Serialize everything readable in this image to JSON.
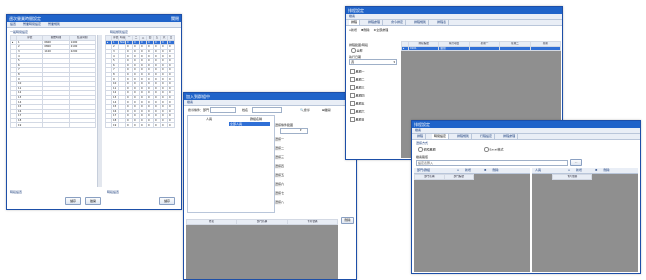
{
  "w1": {
    "title": "週次營業時間設定",
    "close": "關閉",
    "menu": [
      "設置",
      "營業時間設定",
      "營業規則"
    ],
    "left_section": "一般時間設定",
    "left_headers": [
      "序號",
      "開始時間",
      "結束時間"
    ],
    "left_rows": [
      [
        "1",
        "0600",
        "1400"
      ],
      [
        "2",
        "0800",
        "2100"
      ],
      [
        "3",
        "1100",
        "2200"
      ],
      [
        "4",
        "",
        ""
      ],
      [
        "5",
        "",
        ""
      ],
      [
        "6",
        "",
        ""
      ],
      [
        "7",
        "",
        ""
      ],
      [
        "8",
        "",
        ""
      ],
      [
        "9",
        "",
        ""
      ],
      [
        "10",
        "",
        ""
      ],
      [
        "11",
        "",
        ""
      ],
      [
        "12",
        "",
        ""
      ],
      [
        "13",
        "",
        ""
      ],
      [
        "14",
        "",
        ""
      ],
      [
        "15",
        "",
        ""
      ],
      [
        "16",
        "",
        ""
      ],
      [
        "17",
        "",
        ""
      ],
      [
        "18",
        "",
        ""
      ],
      [
        "19",
        "",
        ""
      ]
    ],
    "right_section": "時段類別設定",
    "right_headers": [
      "序號",
      "時段名稱",
      "一",
      "二",
      "三",
      "四",
      "五",
      "六",
      "日"
    ],
    "right_rows": [
      [
        "1",
        "Normal",
        "0",
        "0",
        "0",
        "0",
        "0",
        "0",
        "0"
      ],
      [
        "2",
        "",
        "0",
        "0",
        "0",
        "0",
        "0",
        "0",
        "0"
      ],
      [
        "3",
        "",
        "0",
        "0",
        "0",
        "0",
        "0",
        "0",
        "0"
      ],
      [
        "4",
        "",
        "0",
        "0",
        "0",
        "0",
        "0",
        "0",
        "0"
      ],
      [
        "5",
        "",
        "0",
        "0",
        "0",
        "0",
        "0",
        "0",
        "0"
      ],
      [
        "6",
        "",
        "0",
        "0",
        "0",
        "0",
        "0",
        "0",
        "0"
      ],
      [
        "7",
        "",
        "0",
        "0",
        "0",
        "0",
        "0",
        "0",
        "0"
      ],
      [
        "8",
        "",
        "0",
        "0",
        "0",
        "0",
        "0",
        "0",
        "0"
      ],
      [
        "9",
        "",
        "0",
        "0",
        "0",
        "0",
        "0",
        "0",
        "0"
      ],
      [
        "10",
        "",
        "0",
        "0",
        "0",
        "0",
        "0",
        "0",
        "0"
      ],
      [
        "11",
        "",
        "0",
        "0",
        "0",
        "0",
        "0",
        "0",
        "0"
      ],
      [
        "12",
        "",
        "0",
        "0",
        "0",
        "0",
        "0",
        "0",
        "0"
      ],
      [
        "13",
        "",
        "0",
        "0",
        "0",
        "0",
        "0",
        "0",
        "0"
      ],
      [
        "14",
        "",
        "0",
        "0",
        "0",
        "0",
        "0",
        "0",
        "0"
      ],
      [
        "15",
        "",
        "0",
        "0",
        "0",
        "0",
        "0",
        "0",
        "0"
      ],
      [
        "16",
        "",
        "0",
        "0",
        "0",
        "0",
        "0",
        "0",
        "0"
      ],
      [
        "17",
        "",
        "0",
        "0",
        "0",
        "0",
        "0",
        "0",
        "0"
      ],
      [
        "18",
        "",
        "0",
        "0",
        "0",
        "0",
        "0",
        "0",
        "0"
      ],
      [
        "19",
        "",
        "0",
        "0",
        "0",
        "0",
        "0",
        "0",
        "0"
      ]
    ],
    "left_footer": "時段設置",
    "right_footer": "時段設置",
    "save": "儲存",
    "cancel": "離開"
  },
  "w2": {
    "title": "加入到群組中",
    "close": "關閉",
    "menu": "檔案",
    "search_label": "搜尋條件：部門",
    "name_label": "姓名",
    "search": "搜尋",
    "exit": "離開",
    "col_person": "人員",
    "col_group": "群組名稱",
    "selected": "全部人員",
    "dropdown_label": "選擇條件範圍",
    "options": [
      "選擇一",
      "選擇二",
      "選擇三",
      "選擇四",
      "選擇五",
      "選擇六",
      "選擇七",
      "選擇八"
    ],
    "bottom_headers": [
      "姓名",
      "部門名稱",
      "卡片號碼"
    ],
    "side_button": "刪除"
  },
  "w3": {
    "title": "排程設定",
    "menu": "檔案",
    "tabs": [
      "排程",
      "排程處理",
      "會今排定",
      "排程規則",
      "排程表"
    ],
    "btn_new": "新增",
    "btn_delete": "刪除",
    "btn_all": "全部處理",
    "side_label1": "排程範圍/時段",
    "side_radio": "全部",
    "side_label2": "執行日期",
    "side_select": "週",
    "side_checks": [
      "星期一",
      "星期二",
      "星期三",
      "星期四",
      "星期五",
      "星期六",
      "星期日"
    ],
    "grid_headers": [
      "排程編號",
      "執行項目",
      "星期一",
      "星期二",
      "星期"
    ],
    "sel_row": [
      "0101",
      "關閉"
    ]
  },
  "w4": {
    "title": "排程設定",
    "menu": "檔案",
    "tabs": [
      "排程",
      "時間設定",
      "排程規則",
      "行程設定",
      "排程處理"
    ],
    "section": "選擇方式",
    "radio1": "依照星期",
    "radio2": "Excel格式",
    "field_label": "檔案路徑",
    "field_value": "設定表匯入",
    "browse": "...",
    "left_panel": "部門/群組",
    "left_new": "新增",
    "left_delete": "刪除",
    "left_headers": [
      "部門名稱",
      "部門編號"
    ],
    "right_panel": "人員",
    "right_new": "新增",
    "right_delete": "刪除",
    "right_headers": [
      "卡片號碼"
    ]
  }
}
